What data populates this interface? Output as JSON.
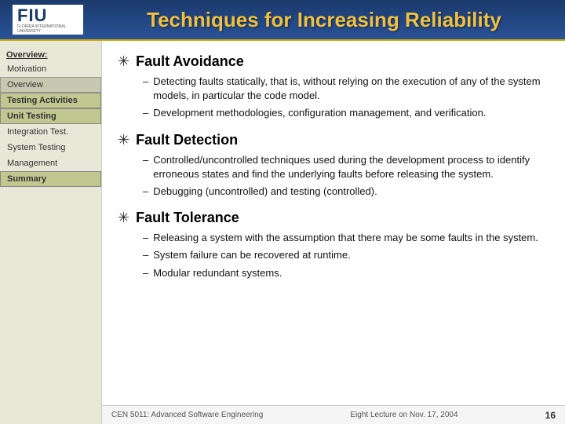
{
  "header": {
    "title": "Techniques for Increasing Reliability",
    "logo": "FIU",
    "logo_sub": "FLORIDA INTERNATIONAL UNIVERSITY"
  },
  "sidebar": {
    "overview_label": "Overview:",
    "items": [
      {
        "id": "motivation",
        "label": "Motivation",
        "state": "normal"
      },
      {
        "id": "overview",
        "label": "Overview",
        "state": "active"
      },
      {
        "id": "testing-activities",
        "label": "Testing Activities",
        "state": "highlighted"
      },
      {
        "id": "unit-testing",
        "label": "Unit Testing",
        "state": "highlighted"
      },
      {
        "id": "integration-test",
        "label": "Integration Test.",
        "state": "normal"
      },
      {
        "id": "system-testing",
        "label": "System Testing",
        "state": "normal"
      },
      {
        "id": "management",
        "label": "Management",
        "state": "normal"
      },
      {
        "id": "summary",
        "label": "Summary",
        "state": "highlighted"
      }
    ]
  },
  "content": {
    "sections": [
      {
        "id": "fault-avoidance",
        "title": "Fault Avoidance",
        "items": [
          "Detecting faults statically, that is, without relying on the execution of any of the system models, in particular the code model.",
          "Development methodologies, configuration management, and verification."
        ]
      },
      {
        "id": "fault-detection",
        "title": "Fault Detection",
        "items": [
          "Controlled/uncontrolled techniques used during the development process to identify erroneous states and find the underlying faults before releasing the system.",
          "Debugging (uncontrolled) and testing (controlled)."
        ]
      },
      {
        "id": "fault-tolerance",
        "title": "Fault Tolerance",
        "items": [
          "Releasing a system with the assumption that there may be some faults in the system.",
          "System failure can be recovered at runtime.",
          "Modular redundant systems."
        ]
      }
    ]
  },
  "footer": {
    "left": "CEN 5011: Advanced Software Engineering",
    "right_label": "Eight Lecture on Nov. 17, 2004",
    "page": "16"
  }
}
